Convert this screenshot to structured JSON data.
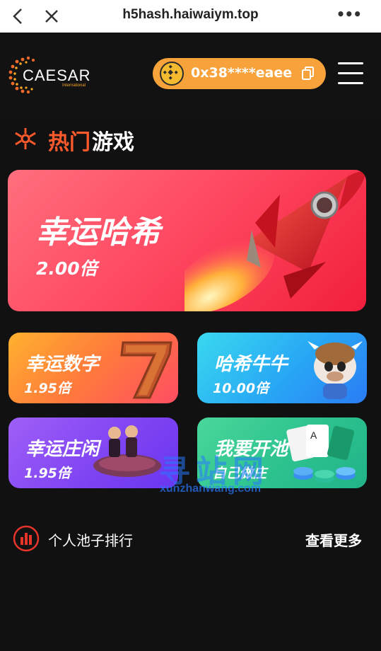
{
  "browser": {
    "url": "h5hash.haiwaiym.top",
    "more_label": "•••"
  },
  "header": {
    "logo_text": "CAESAR",
    "logo_sub": "International",
    "wallet_address": "0x38****eaee"
  },
  "hot_games": {
    "title_part1": "热门",
    "title_part2": "游戏"
  },
  "games": [
    {
      "name": "幸运哈希",
      "multiplier": "2.00倍"
    },
    {
      "name": "幸运数字",
      "multiplier": "1.95倍"
    },
    {
      "name": "哈希牛牛",
      "multiplier": "10.00倍"
    },
    {
      "name": "幸运庄闲",
      "multiplier": "1.95倍"
    },
    {
      "name": "我要开池",
      "multiplier": "自己做庄"
    }
  ],
  "ranking": {
    "label": "个人池子排行",
    "more": "查看更多"
  },
  "watermark": {
    "text": "寻站网",
    "sub": "xunzhanwang.com"
  },
  "colors": {
    "accent_orange": "#f7a23a",
    "title_red": "#ff5a2c",
    "background": "#111111"
  }
}
